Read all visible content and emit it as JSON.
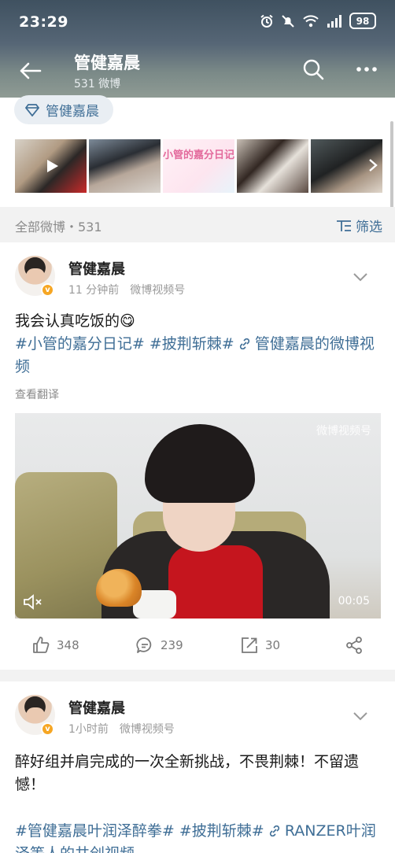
{
  "status_bar": {
    "time": "23:29",
    "battery": "98",
    "icons": [
      "alarm-icon",
      "mute-icon",
      "wifi-6-icon",
      "signal-icon",
      "battery-icon"
    ]
  },
  "header": {
    "name": "管健嘉晨",
    "count": "531 微博"
  },
  "profile_tag": {
    "label": "管健嘉晨",
    "icon": "diamond-icon"
  },
  "media_strip": {
    "collection_title": "小管的嘉分日记"
  },
  "filter_bar": {
    "label": "全部微博・531",
    "filter_label": "筛选"
  },
  "posts": [
    {
      "author": "管健嘉晨",
      "time": "11 分钟前",
      "source": "微博视频号",
      "text_plain": "我会认真吃饭的",
      "emoji": "😋",
      "tag_1": "#小管的嘉分日记#",
      "tag_2": "#披荆斩棘#",
      "link": "管健嘉晨的微博视频",
      "translate": "查看翻译",
      "video": {
        "watermark": "微博视频号",
        "duration": "00:05"
      },
      "likes": "348",
      "comments": "239",
      "reposts": "30"
    },
    {
      "author": "管健嘉晨",
      "time": "1小时前",
      "source": "微博视频号",
      "text_plain": "醉好组并肩完成的一次全新挑战，不畏荆棘！不留遗憾！",
      "tag_1": "#管健嘉晨叶润泽醉拳#",
      "tag_2": "#披荆斩棘#",
      "link": "RANZER叶润泽等人的共创视频"
    }
  ],
  "colors": {
    "link": "#3f6e96",
    "verified": "#f6a623",
    "header_top": "#3f5160"
  }
}
